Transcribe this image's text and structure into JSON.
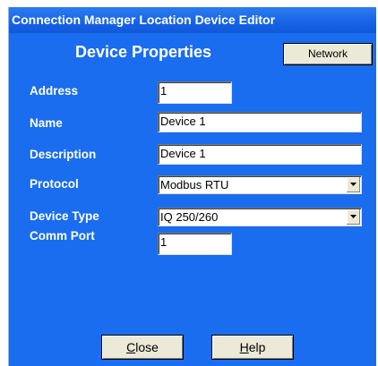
{
  "window": {
    "title": "Connection Manager Location Device Editor"
  },
  "header": {
    "heading": "Device Properties",
    "network_label": "Network"
  },
  "fields": {
    "address": {
      "label": "Address",
      "value": "1"
    },
    "name": {
      "label": "Name",
      "value": "Device 1"
    },
    "description": {
      "label": "Description",
      "value": "Device 1"
    },
    "protocol": {
      "label": "Protocol",
      "value": "Modbus RTU"
    },
    "device_type": {
      "label": "Device Type",
      "value": "IQ 250/260"
    },
    "comm_port": {
      "label": "Comm Port",
      "value": "1"
    }
  },
  "footer": {
    "close_mnemonic": "C",
    "close_rest": "lose",
    "help_mnemonic": "H",
    "help_rest": "elp"
  },
  "colors": {
    "window_background": "#1a6dee",
    "button_face": "#ece9d8"
  },
  "icons": {
    "dropdown": "chevron-down-icon"
  }
}
